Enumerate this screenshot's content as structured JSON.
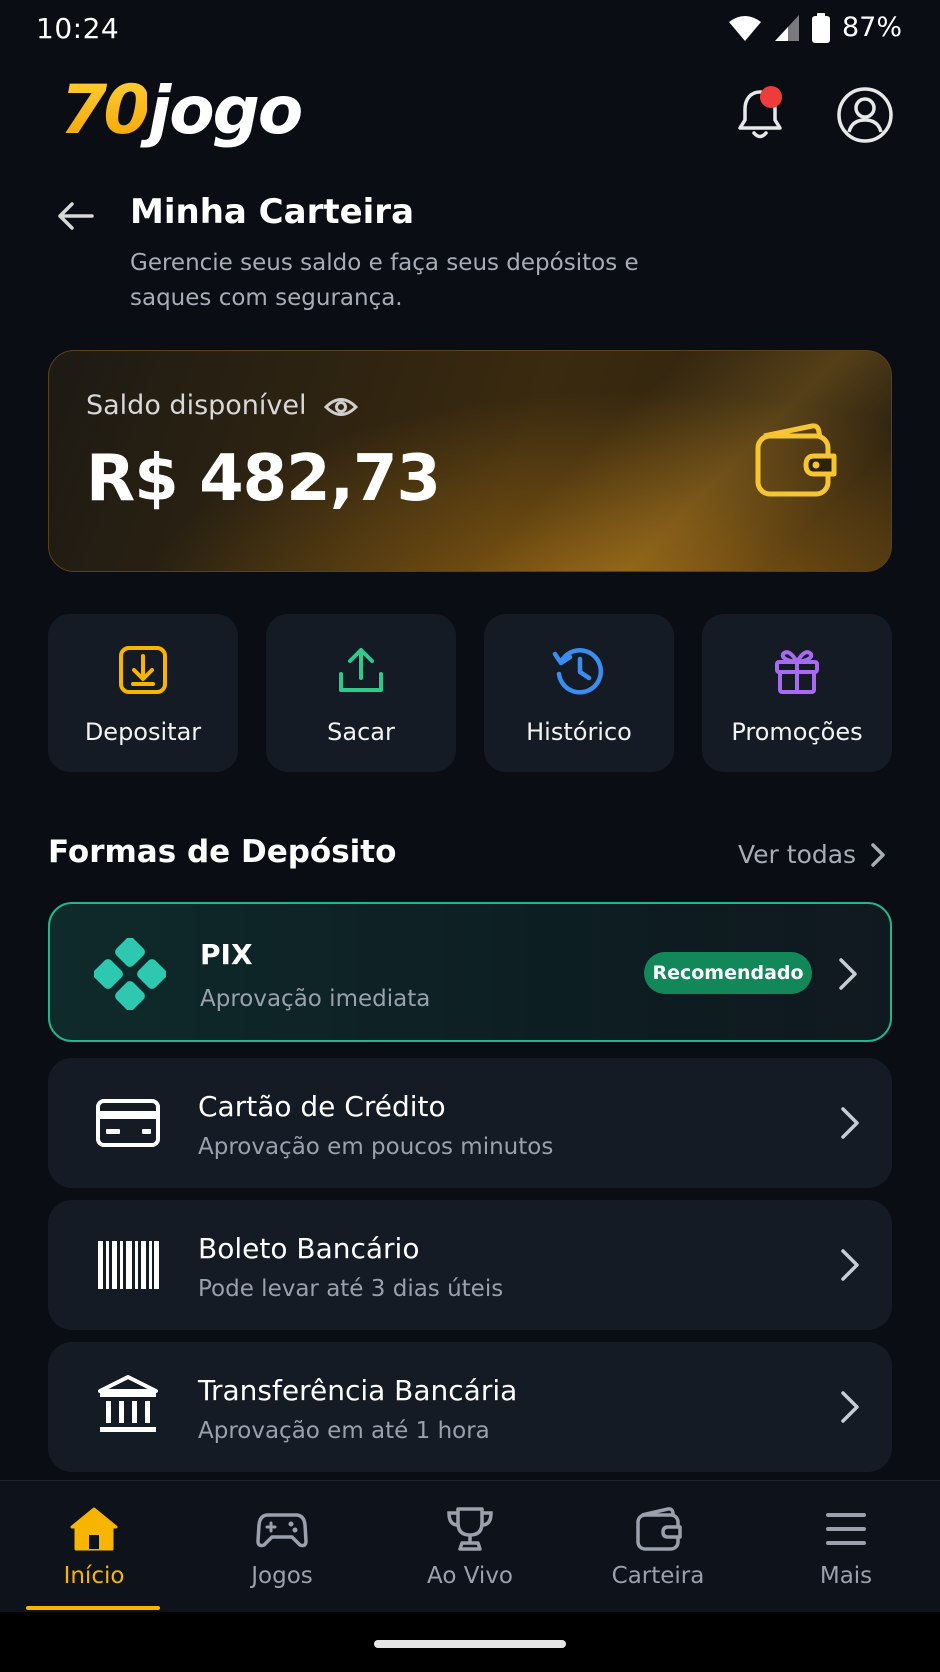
{
  "status_bar": {
    "time": "10:24",
    "battery": "87%"
  },
  "brand": {
    "logo_number": "70",
    "logo_word": "jogo",
    "accent_color": "#f7b500"
  },
  "header": {
    "notification_dot_color": "#ef3b3b"
  },
  "page": {
    "title": "Minha Carteira",
    "subtitle": "Gerencie seus saldo e faça seus depósitos e saques com segurança."
  },
  "balance": {
    "label": "Saldo disponível",
    "value": "R$ 482,73"
  },
  "actions": [
    {
      "label": "Depositar",
      "icon": "deposit-icon",
      "color": "#f7b500"
    },
    {
      "label": "Sacar",
      "icon": "upload-icon",
      "color": "#2ec98b"
    },
    {
      "label": "Histórico",
      "icon": "history-icon",
      "color": "#3b8df0"
    },
    {
      "label": "Promoções",
      "icon": "gift-icon",
      "color": "#a66bf0"
    }
  ],
  "deposit_section": {
    "title": "Formas de Depósito",
    "see_all": "Ver todas",
    "methods": [
      {
        "title": "PIX",
        "subtitle": "Aprovação imediata",
        "badge": "Recomendado",
        "icon": "pix-icon"
      },
      {
        "title": "Cartão de Crédito",
        "subtitle": "Aprovação em poucos minutos",
        "icon": "credit-card-icon"
      },
      {
        "title": "Boleto Bancário",
        "subtitle": "Pode levar até 3 dias úteis",
        "icon": "barcode-icon"
      },
      {
        "title": "Transferência Bancária",
        "subtitle": "Aprovação em até 1 hora",
        "icon": "bank-icon"
      }
    ]
  },
  "bottom_nav": [
    {
      "label": "Início",
      "icon": "home-icon",
      "active": true
    },
    {
      "label": "Jogos",
      "icon": "gamepad-icon",
      "active": false
    },
    {
      "label": "Ao Vivo",
      "icon": "trophy-icon",
      "active": false
    },
    {
      "label": "Carteira",
      "icon": "wallet-icon",
      "active": false
    },
    {
      "label": "Mais",
      "icon": "menu-icon",
      "active": false
    }
  ]
}
